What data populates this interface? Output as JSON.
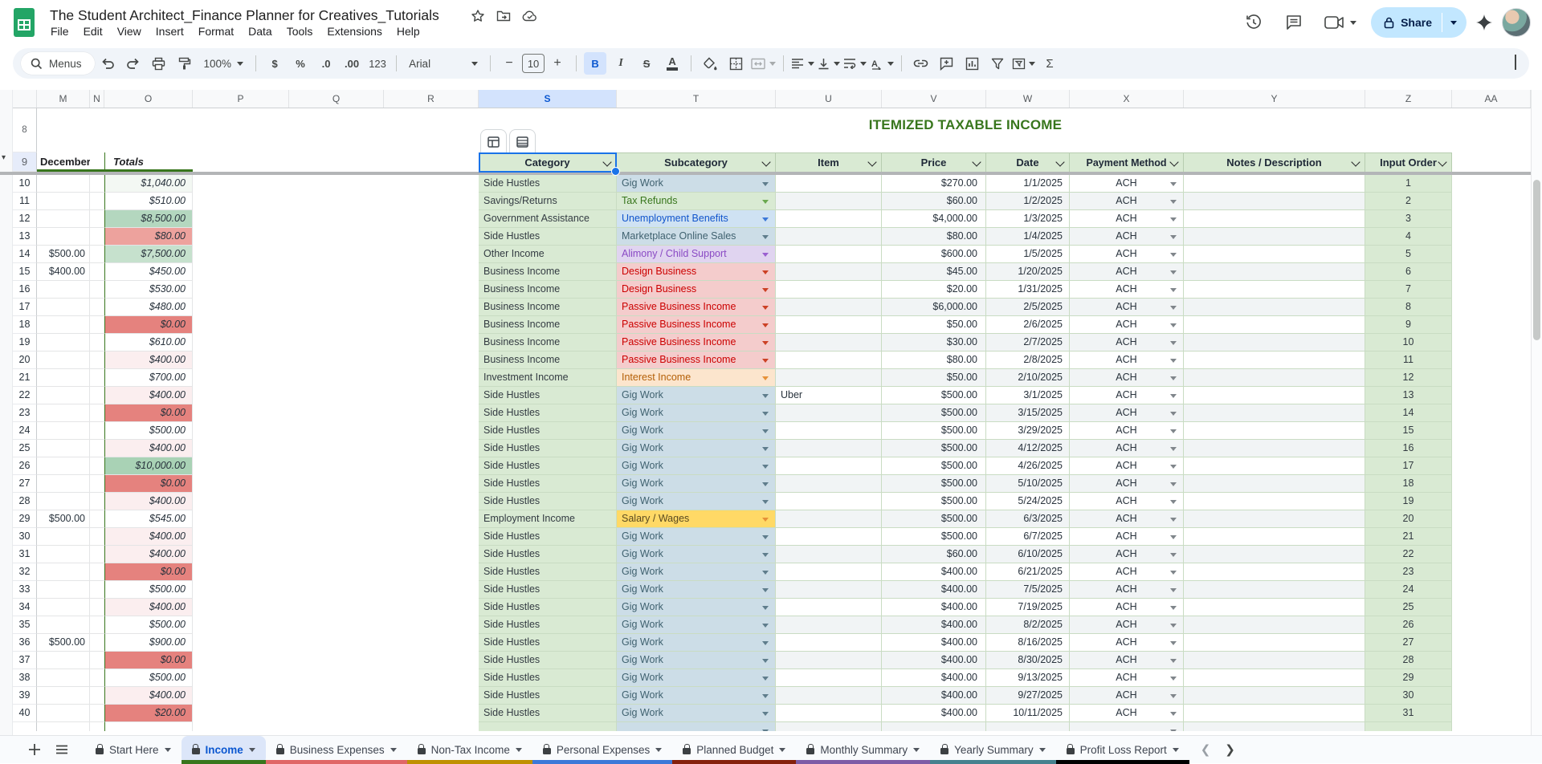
{
  "titlebar": {
    "doc_title": "The Student Architect_Finance Planner for Creatives_Tutorials",
    "menus": [
      "File",
      "Edit",
      "View",
      "Insert",
      "Format",
      "Data",
      "Tools",
      "Extensions",
      "Help"
    ],
    "share_label": "Share"
  },
  "toolbar": {
    "menus_label": "Menus",
    "zoom": "100%",
    "currency": "$",
    "percent": "%",
    "dec_decrease": ".0",
    "dec_increase": ".00",
    "more_formats": "123",
    "font_name": "Arial",
    "font_size": "10",
    "bold": "B",
    "italic": "I",
    "strike": "S",
    "text_color": "A",
    "functions": "Σ"
  },
  "grid": {
    "column_letters": [
      "M",
      "N",
      "O",
      "P",
      "Q",
      "R",
      "S",
      "T",
      "U",
      "V",
      "W",
      "X",
      "Y",
      "Z",
      "AA"
    ],
    "selected_column": "S",
    "row8_label": "8",
    "row9_label": "9",
    "title": "ITEMIZED TAXABLE INCOME",
    "left_header": {
      "december": "December",
      "totals": "Totals"
    },
    "header_row": [
      "Category",
      "Subcategory",
      "Item",
      "Price",
      "Date",
      "Payment Method",
      "Notes / Description",
      "Input Order"
    ],
    "rows": [
      {
        "row": "10",
        "m": "",
        "total": "$1,040.00",
        "tbg": "g4",
        "cat": "Side Hustles",
        "sub": "Gig Work",
        "th": "gig",
        "item": "",
        "price": "$270.00",
        "date": "1/1/2025",
        "pay": "ACH",
        "ord": "1"
      },
      {
        "row": "11",
        "m": "",
        "total": "$510.00",
        "tbg": "",
        "cat": "Savings/Returns",
        "sub": "Tax Refunds",
        "th": "green",
        "item": "",
        "price": "$60.00",
        "date": "1/2/2025",
        "pay": "ACH",
        "ord": "2"
      },
      {
        "row": "12",
        "m": "",
        "total": "$8,500.00",
        "tbg": "g2",
        "cat": "Government Assistance",
        "sub": "Unemployment Benefits",
        "th": "blue",
        "item": "",
        "price": "$4,000.00",
        "date": "1/3/2025",
        "pay": "ACH",
        "ord": "3"
      },
      {
        "row": "13",
        "m": "",
        "total": "$80.00",
        "tbg": "r2",
        "cat": "Side Hustles",
        "sub": "Marketplace Online Sales",
        "th": "gig",
        "item": "",
        "price": "$80.00",
        "date": "1/4/2025",
        "pay": "ACH",
        "ord": "4"
      },
      {
        "row": "14",
        "m": "$500.00",
        "total": "$7,500.00",
        "tbg": "g3",
        "cat": "Other Income",
        "sub": "Alimony / Child Support",
        "th": "purple",
        "item": "",
        "price": "$600.00",
        "date": "1/5/2025",
        "pay": "ACH",
        "ord": "5"
      },
      {
        "row": "15",
        "m": "$400.00",
        "total": "$450.00",
        "tbg": "",
        "cat": "Business Income",
        "sub": "Design Business",
        "th": "red",
        "item": "",
        "price": "$45.00",
        "date": "1/20/2025",
        "pay": "ACH",
        "ord": "6"
      },
      {
        "row": "16",
        "m": "",
        "total": "$530.00",
        "tbg": "",
        "cat": "Business Income",
        "sub": "Design Business",
        "th": "red",
        "item": "",
        "price": "$20.00",
        "date": "1/31/2025",
        "pay": "ACH",
        "ord": "7"
      },
      {
        "row": "17",
        "m": "",
        "total": "$480.00",
        "tbg": "",
        "cat": "Business Income",
        "sub": "Passive Business Income",
        "th": "red",
        "item": "",
        "price": "$6,000.00",
        "date": "2/5/2025",
        "pay": "ACH",
        "ord": "8"
      },
      {
        "row": "18",
        "m": "",
        "total": "$0.00",
        "tbg": "r1",
        "cat": "Business Income",
        "sub": "Passive Business Income",
        "th": "red",
        "item": "",
        "price": "$50.00",
        "date": "2/6/2025",
        "pay": "ACH",
        "ord": "9"
      },
      {
        "row": "19",
        "m": "",
        "total": "$610.00",
        "tbg": "",
        "cat": "Business Income",
        "sub": "Passive Business Income",
        "th": "red",
        "item": "",
        "price": "$30.00",
        "date": "2/7/2025",
        "pay": "ACH",
        "ord": "10"
      },
      {
        "row": "20",
        "m": "",
        "total": "$400.00",
        "tbg": "r3",
        "cat": "Business Income",
        "sub": "Passive Business Income",
        "th": "red",
        "item": "",
        "price": "$80.00",
        "date": "2/8/2025",
        "pay": "ACH",
        "ord": "11"
      },
      {
        "row": "21",
        "m": "",
        "total": "$700.00",
        "tbg": "",
        "cat": "Investment Income",
        "sub": "Interest Income",
        "th": "orange",
        "item": "",
        "price": "$50.00",
        "date": "2/10/2025",
        "pay": "ACH",
        "ord": "12"
      },
      {
        "row": "22",
        "m": "",
        "total": "$400.00",
        "tbg": "r3",
        "cat": "Side Hustles",
        "sub": "Gig Work",
        "th": "gig",
        "item": "Uber",
        "price": "$500.00",
        "date": "3/1/2025",
        "pay": "ACH",
        "ord": "13"
      },
      {
        "row": "23",
        "m": "",
        "total": "$0.00",
        "tbg": "r1",
        "cat": "Side Hustles",
        "sub": "Gig Work",
        "th": "gig",
        "item": "",
        "price": "$500.00",
        "date": "3/15/2025",
        "pay": "ACH",
        "ord": "14"
      },
      {
        "row": "24",
        "m": "",
        "total": "$500.00",
        "tbg": "",
        "cat": "Side Hustles",
        "sub": "Gig Work",
        "th": "gig",
        "item": "",
        "price": "$500.00",
        "date": "3/29/2025",
        "pay": "ACH",
        "ord": "15"
      },
      {
        "row": "25",
        "m": "",
        "total": "$400.00",
        "tbg": "r3",
        "cat": "Side Hustles",
        "sub": "Gig Work",
        "th": "gig",
        "item": "",
        "price": "$500.00",
        "date": "4/12/2025",
        "pay": "ACH",
        "ord": "16"
      },
      {
        "row": "26",
        "m": "",
        "total": "$10,000.00",
        "tbg": "g1",
        "cat": "Side Hustles",
        "sub": "Gig Work",
        "th": "gig",
        "item": "",
        "price": "$500.00",
        "date": "4/26/2025",
        "pay": "ACH",
        "ord": "17"
      },
      {
        "row": "27",
        "m": "",
        "total": "$0.00",
        "tbg": "r1",
        "cat": "Side Hustles",
        "sub": "Gig Work",
        "th": "gig",
        "item": "",
        "price": "$500.00",
        "date": "5/10/2025",
        "pay": "ACH",
        "ord": "18"
      },
      {
        "row": "28",
        "m": "",
        "total": "$400.00",
        "tbg": "r3",
        "cat": "Side Hustles",
        "sub": "Gig Work",
        "th": "gig",
        "item": "",
        "price": "$500.00",
        "date": "5/24/2025",
        "pay": "ACH",
        "ord": "19"
      },
      {
        "row": "29",
        "m": "$500.00",
        "total": "$545.00",
        "tbg": "",
        "cat": "Employment Income",
        "sub": "Salary / Wages",
        "th": "yellow",
        "item": "",
        "price": "$500.00",
        "date": "6/3/2025",
        "pay": "ACH",
        "ord": "20"
      },
      {
        "row": "30",
        "m": "",
        "total": "$400.00",
        "tbg": "r3",
        "cat": "Side Hustles",
        "sub": "Gig Work",
        "th": "gig",
        "item": "",
        "price": "$500.00",
        "date": "6/7/2025",
        "pay": "ACH",
        "ord": "21"
      },
      {
        "row": "31",
        "m": "",
        "total": "$400.00",
        "tbg": "r3",
        "cat": "Side Hustles",
        "sub": "Gig Work",
        "th": "gig",
        "item": "",
        "price": "$60.00",
        "date": "6/10/2025",
        "pay": "ACH",
        "ord": "22"
      },
      {
        "row": "32",
        "m": "",
        "total": "$0.00",
        "tbg": "r1",
        "cat": "Side Hustles",
        "sub": "Gig Work",
        "th": "gig",
        "item": "",
        "price": "$400.00",
        "date": "6/21/2025",
        "pay": "ACH",
        "ord": "23"
      },
      {
        "row": "33",
        "m": "",
        "total": "$500.00",
        "tbg": "",
        "cat": "Side Hustles",
        "sub": "Gig Work",
        "th": "gig",
        "item": "",
        "price": "$400.00",
        "date": "7/5/2025",
        "pay": "ACH",
        "ord": "24"
      },
      {
        "row": "34",
        "m": "",
        "total": "$400.00",
        "tbg": "r3",
        "cat": "Side Hustles",
        "sub": "Gig Work",
        "th": "gig",
        "item": "",
        "price": "$400.00",
        "date": "7/19/2025",
        "pay": "ACH",
        "ord": "25"
      },
      {
        "row": "35",
        "m": "",
        "total": "$500.00",
        "tbg": "",
        "cat": "Side Hustles",
        "sub": "Gig Work",
        "th": "gig",
        "item": "",
        "price": "$400.00",
        "date": "8/2/2025",
        "pay": "ACH",
        "ord": "26"
      },
      {
        "row": "36",
        "m": "$500.00",
        "total": "$900.00",
        "tbg": "",
        "cat": "Side Hustles",
        "sub": "Gig Work",
        "th": "gig",
        "item": "",
        "price": "$400.00",
        "date": "8/16/2025",
        "pay": "ACH",
        "ord": "27"
      },
      {
        "row": "37",
        "m": "",
        "total": "$0.00",
        "tbg": "r1",
        "cat": "Side Hustles",
        "sub": "Gig Work",
        "th": "gig",
        "item": "",
        "price": "$400.00",
        "date": "8/30/2025",
        "pay": "ACH",
        "ord": "28"
      },
      {
        "row": "38",
        "m": "",
        "total": "$500.00",
        "tbg": "",
        "cat": "Side Hustles",
        "sub": "Gig Work",
        "th": "gig",
        "item": "",
        "price": "$400.00",
        "date": "9/13/2025",
        "pay": "ACH",
        "ord": "29"
      },
      {
        "row": "39",
        "m": "",
        "total": "$400.00",
        "tbg": "r3",
        "cat": "Side Hustles",
        "sub": "Gig Work",
        "th": "gig",
        "item": "",
        "price": "$400.00",
        "date": "9/27/2025",
        "pay": "ACH",
        "ord": "30"
      },
      {
        "row": "40",
        "m": "",
        "total": "$20.00",
        "tbg": "r1",
        "cat": "Side Hustles",
        "sub": "Gig Work",
        "th": "gig",
        "item": "",
        "price": "$400.00",
        "date": "10/11/2025",
        "pay": "ACH",
        "ord": "31"
      }
    ]
  },
  "colors": {
    "accent_blue": "#1a73e8",
    "title_green": "#38761d",
    "header_cell_green": "#d9ead3",
    "band_gray": "#f1f4f5",
    "subcat_themes": {
      "gig": {
        "bg": "#ccdde7",
        "fg": "#3f616f",
        "arrow": "#5f7d8c"
      },
      "green": {
        "bg": "#d9ead3",
        "fg": "#38761d",
        "arrow": "#6aa84f"
      },
      "blue": {
        "bg": "#cfe2f3",
        "fg": "#1155cc",
        "arrow": "#3c78d8"
      },
      "purple": {
        "bg": "#e0d4f0",
        "fg": "#8a4ac4",
        "arrow": "#9a5fd0"
      },
      "red": {
        "bg": "#f4cccc",
        "fg": "#cc0000",
        "arrow": "#cc4125"
      },
      "orange": {
        "bg": "#fce5cd",
        "fg": "#b45f06",
        "arrow": "#e69138"
      },
      "yellow": {
        "bg": "#ffd966",
        "fg": "#594a21",
        "arrow": "#e69138"
      }
    },
    "total_bgs": {
      "g1": "#a9d2b5",
      "g2": "#b4d7bf",
      "g3": "#c6e1cd",
      "g4": "#f3f8f3",
      "r1": "#e5827e",
      "r2": "#eda29d",
      "r3": "#fbeeef"
    }
  },
  "sheet_tabs": {
    "tabs": [
      {
        "label": "Start Here",
        "color": "",
        "active": false
      },
      {
        "label": "Income",
        "color": "#38761d",
        "active": true
      },
      {
        "label": "Business Expenses",
        "color": "#e06666",
        "active": false
      },
      {
        "label": "Non-Tax Income",
        "color": "#bf9000",
        "active": false
      },
      {
        "label": "Personal Expenses",
        "color": "#3c78d8",
        "active": false
      },
      {
        "label": "Planned Budget",
        "color": "#85200c",
        "active": false
      },
      {
        "label": "Monthly Summary",
        "color": "#7d5ba6",
        "active": false
      },
      {
        "label": "Yearly Summary",
        "color": "#45818e",
        "active": false
      },
      {
        "label": "Profit Loss Report",
        "color": "#000000",
        "active": false
      }
    ]
  }
}
